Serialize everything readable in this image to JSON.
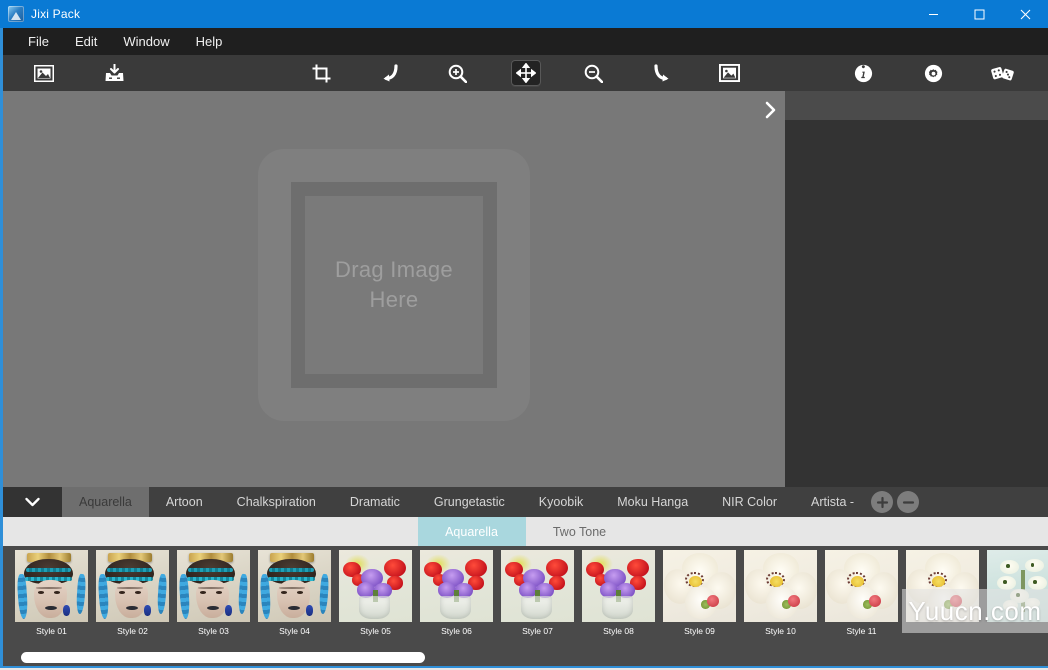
{
  "window": {
    "title": "Jixi Pack",
    "icon": "app-logo-icon",
    "controls": {
      "minimize": "minimize",
      "maximize": "maximize",
      "close": "close"
    }
  },
  "menubar": {
    "items": [
      {
        "label": "File"
      },
      {
        "label": "Edit"
      },
      {
        "label": "Window"
      },
      {
        "label": "Help"
      }
    ]
  },
  "toolbar": {
    "left": [
      {
        "name": "open-image-icon",
        "tooltip": "Open Image"
      },
      {
        "name": "save-image-icon",
        "tooltip": "Save Image"
      }
    ],
    "center": [
      {
        "name": "crop-icon",
        "tooltip": "Crop",
        "active": false
      },
      {
        "name": "undo-icon",
        "tooltip": "Undo",
        "active": false
      },
      {
        "name": "zoom-in-icon",
        "tooltip": "Zoom In",
        "active": false
      },
      {
        "name": "move-icon",
        "tooltip": "Move / Pan",
        "active": true
      },
      {
        "name": "zoom-out-icon",
        "tooltip": "Zoom Out",
        "active": false
      },
      {
        "name": "redo-icon",
        "tooltip": "Redo",
        "active": false
      },
      {
        "name": "fit-image-icon",
        "tooltip": "Fit To Screen",
        "active": false
      }
    ],
    "right": [
      {
        "name": "info-icon",
        "tooltip": "Info"
      },
      {
        "name": "settings-icon",
        "tooltip": "Settings"
      },
      {
        "name": "dice-icon",
        "tooltip": "Randomize"
      }
    ]
  },
  "canvas": {
    "dropzone_text": "Drag Image Here",
    "collapse_handle": "›"
  },
  "tabbar": {
    "dropdown_icon": "chevron-down-icon",
    "tabs": [
      {
        "label": "Aquarella",
        "active": true
      },
      {
        "label": "Artoon",
        "active": false
      },
      {
        "label": "Chalkspiration",
        "active": false
      },
      {
        "label": "Dramatic",
        "active": false
      },
      {
        "label": "Grungetastic",
        "active": false
      },
      {
        "label": "Kyoobik",
        "active": false
      },
      {
        "label": "Moku Hanga",
        "active": false
      },
      {
        "label": "NIR Color",
        "active": false
      },
      {
        "label": "Artista -",
        "active": false
      }
    ],
    "add_label": "+",
    "remove_label": "−"
  },
  "subtabs": {
    "items": [
      {
        "label": "Aquarella",
        "active": true
      },
      {
        "label": "Two Tone",
        "active": false
      }
    ]
  },
  "thumbnails": {
    "items": [
      {
        "label": "Style 01",
        "art": "portrait"
      },
      {
        "label": "Style 02",
        "art": "portrait"
      },
      {
        "label": "Style 03",
        "art": "portrait"
      },
      {
        "label": "Style 04",
        "art": "portrait"
      },
      {
        "label": "Style 05",
        "art": "flowers"
      },
      {
        "label": "Style 06",
        "art": "flowers"
      },
      {
        "label": "Style 07",
        "art": "flowers"
      },
      {
        "label": "Style 08",
        "art": "flowers"
      },
      {
        "label": "Style 09",
        "art": "orchid"
      },
      {
        "label": "Style 10",
        "art": "orchid"
      },
      {
        "label": "Style 11",
        "art": "orchid"
      },
      {
        "label": "",
        "art": "orchid"
      },
      {
        "label": "",
        "art": "spray"
      }
    ]
  },
  "watermark": {
    "text": "Yuucn.com"
  },
  "colors": {
    "titlebar": "#0a7ad4",
    "menubar": "#1f1f1f",
    "toolbar": "#3a3a3a",
    "canvas": "#787878",
    "right_panel": "#333333",
    "tabbar": "#404040",
    "tab_active": "#6e6e6e",
    "subtabbar": "#e6e6e6",
    "subtab_active": "#a9d7de",
    "thumbstrip": "#4a4a4a",
    "accent_border": "#2f8fd8"
  }
}
